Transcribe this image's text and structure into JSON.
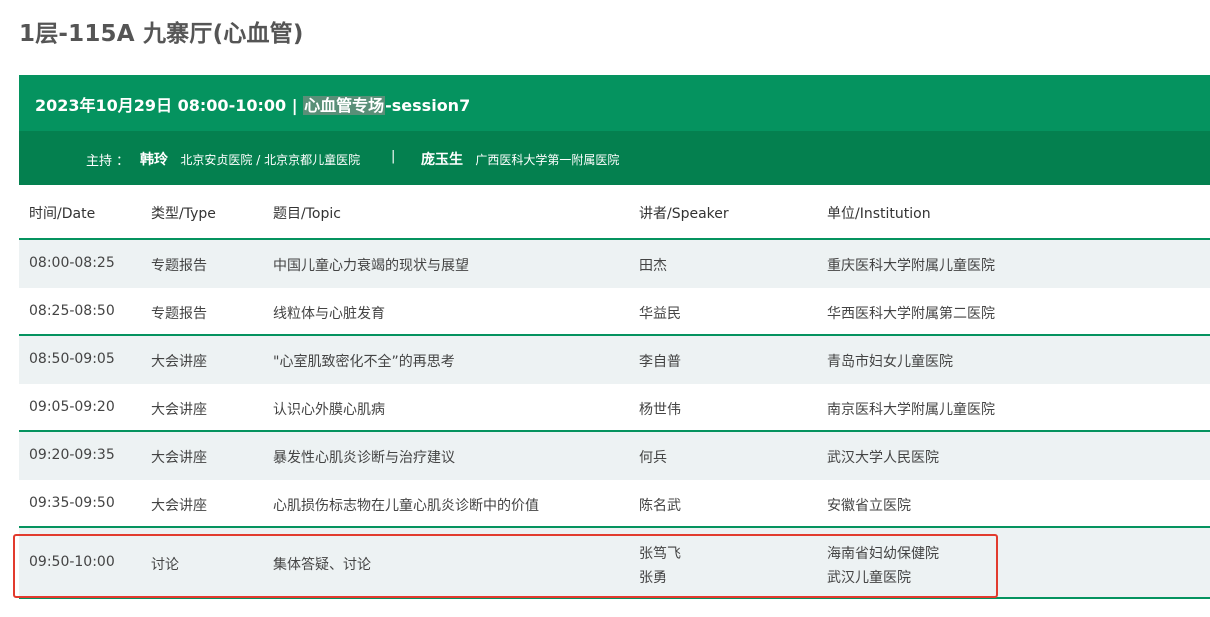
{
  "page": {
    "title": "1层-115A 九寨厅(心血管)"
  },
  "session": {
    "title_prefix": "2023年10月29日 08:00-10:00 | ",
    "title_highlight": "心血管专场",
    "title_suffix": "-session7"
  },
  "hosts": {
    "label": "主持 ：",
    "host1_name": "韩玲",
    "host1_institution": "北京安贞医院 / 北京京都儿童医院",
    "separator": "|",
    "host2_name": "庞玉生",
    "host2_institution": "广西医科大学第一附属医院"
  },
  "table": {
    "headers": {
      "time": "时间/Date",
      "type": "类型/Type",
      "topic": "题目/Topic",
      "speaker": "讲者/Speaker",
      "institution": "单位/Institution"
    },
    "rows": [
      {
        "time": "08:00-08:25",
        "type": "专题报告",
        "topic": "中国儿童心力衰竭的现状与展望",
        "speaker": "田杰",
        "institution": "重庆医科大学附属儿童医院"
      },
      {
        "time": "08:25-08:50",
        "type": "专题报告",
        "topic": "线粒体与心脏发育",
        "speaker": "华益民",
        "institution": "华西医科大学附属第二医院"
      },
      {
        "time": "08:50-09:05",
        "type": "大会讲座",
        "topic": "\"心室肌致密化不全”的再思考",
        "speaker": "李自普",
        "institution": "青岛市妇女儿童医院"
      },
      {
        "time": "09:05-09:20",
        "type": "大会讲座",
        "topic": "认识心外膜心肌病",
        "speaker": "杨世伟",
        "institution": "南京医科大学附属儿童医院"
      },
      {
        "time": "09:20-09:35",
        "type": "大会讲座",
        "topic": "暴发性心肌炎诊断与治疗建议",
        "speaker": "何兵",
        "institution": "武汉大学人民医院"
      },
      {
        "time": "09:35-09:50",
        "type": "大会讲座",
        "topic": "心肌损伤标志物在儿童心肌炎诊断中的价值",
        "speaker": "陈名武",
        "institution": "安徽省立医院"
      },
      {
        "time": "09:50-10:00",
        "type": "讨论",
        "topic": "集体答疑、讨论",
        "speaker": "张笃飞",
        "speaker2": "张勇",
        "institution": "海南省妇幼保健院",
        "institution2": "武汉儿童医院"
      }
    ]
  },
  "colors": {
    "header_green": "#05935f",
    "host_bar_green": "#04804f",
    "row_shade": "#edf2f3",
    "annotation_red": "#e23b2e"
  }
}
